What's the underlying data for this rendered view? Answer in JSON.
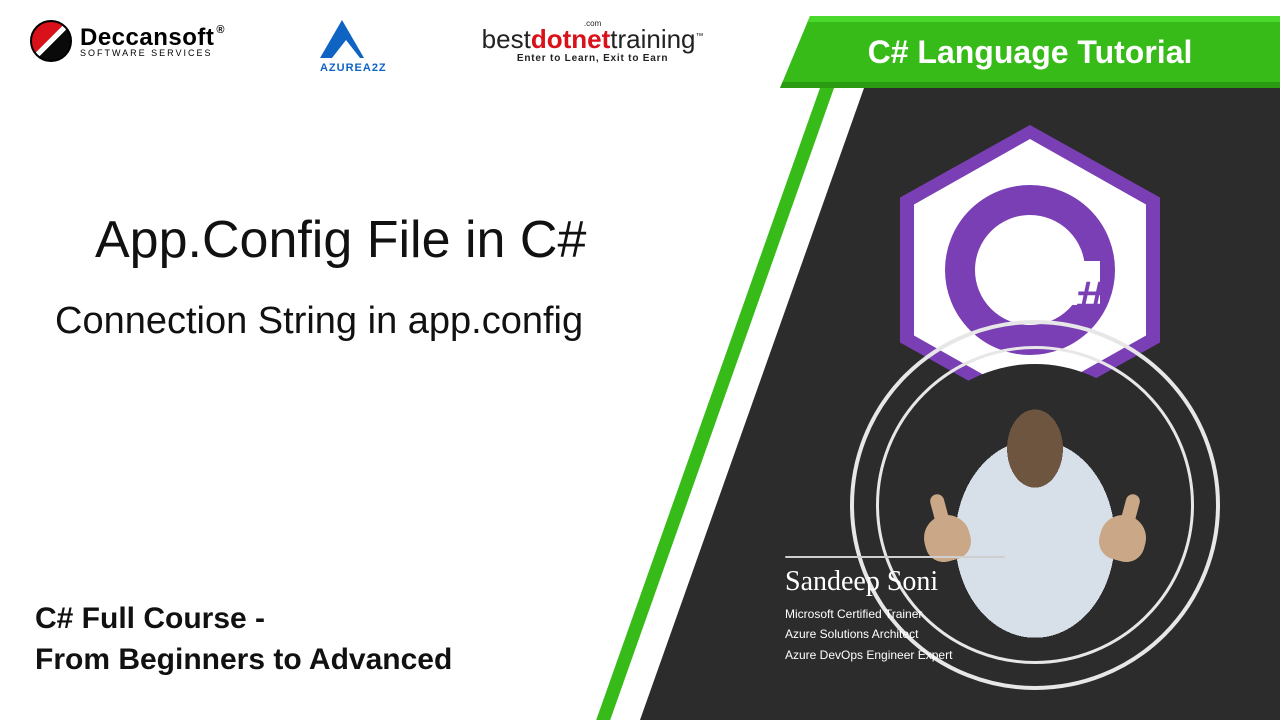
{
  "logos": {
    "deccansoft": {
      "name": "Deccansoft",
      "tag": "SOFTWARE SERVICES"
    },
    "azurea2z": {
      "name": "AZUREA2Z"
    },
    "bdt": {
      "pre": "best",
      "mid": "dotnet",
      "post": "training",
      "tag": "Enter to Learn, Exit to Earn",
      "dotcom": ".com"
    }
  },
  "banner": "C# Language Tutorial",
  "main": {
    "title": "App.Config File in C#",
    "subtitle": "Connection String in app.config"
  },
  "course": {
    "line1": "C# Full Course -",
    "line2": "From Beginners to Advanced"
  },
  "csharp_symbol": "#",
  "presenter": {
    "name": "Sandeep Soni",
    "creds": [
      "Microsoft Certified Trainer",
      "Azure Solutions Architect",
      "Azure DevOps Engineer Expert"
    ]
  }
}
